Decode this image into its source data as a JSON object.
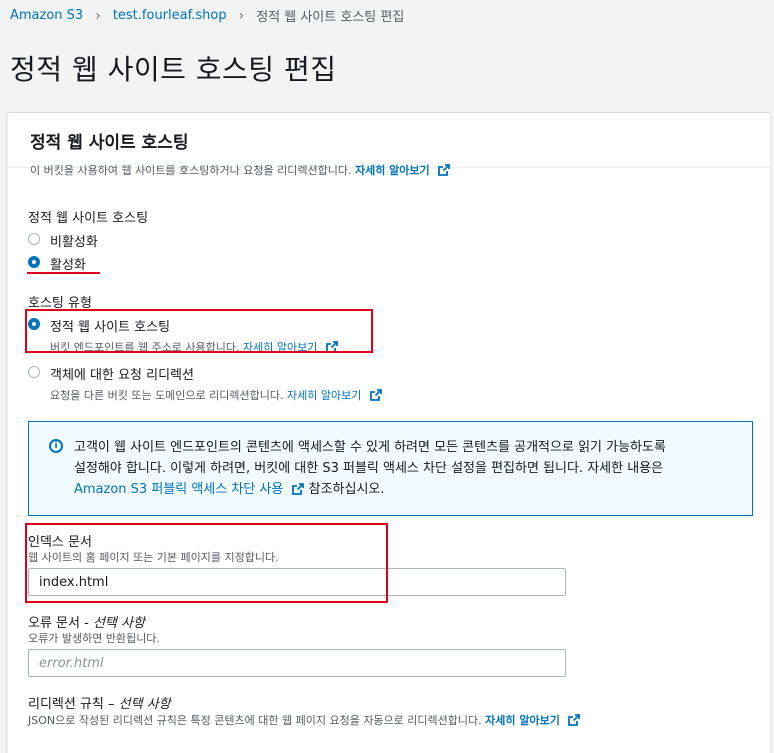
{
  "breadcrumb": {
    "root": "Amazon S3",
    "bucket": "test.fourleaf.shop",
    "current": "정적 웹 사이트 호스팅 편집"
  },
  "page_title": "정적 웹 사이트 호스팅 편집",
  "panel": {
    "title": "정적 웹 사이트 호스팅",
    "desc": "이 버킷을 사용하여 웹 사이트를 호스팅하거나 요청을 리디렉션합니다.",
    "learn_more": "자세히 알아보기"
  },
  "hosting": {
    "label": "정적 웹 사이트 호스팅",
    "opt_disable": "비활성화",
    "opt_enable": "활성화"
  },
  "hosting_type": {
    "label": "호스팅 유형",
    "opt_static": "정적 웹 사이트 호스팅",
    "opt_static_desc": "버킷 엔드포인트를 웹 주소로 사용합니다.",
    "opt_redirect": "객체에 대한 요청 리디렉션",
    "opt_redirect_desc": "요청을 다른 버킷 또는 도메인으로 리디렉션합니다.",
    "learn_more": "자세히 알아보기"
  },
  "info": {
    "line1": "고객이 웹 사이트 엔드포인트의 콘텐츠에 액세스할 수 있게 하려면 모든 콘텐츠를 공개적으로 읽기 가능하도록",
    "line2": "설정해야 합니다. 이렇게 하려면, 버킷에 대한 S3 퍼블릭 액세스 차단 설정을 편집하면 됩니다. 자세한 내용은",
    "link": "Amazon S3 퍼블릭 액세스 차단 사용",
    "tail": "참조하십시오."
  },
  "index_doc": {
    "label": "인덱스 문서",
    "desc": "웹 사이트의 홈 페이지 또는 기본 페이지를 지정합니다.",
    "value": "index.html"
  },
  "error_doc": {
    "label": "오류 문서 - ",
    "optional": "선택 사항",
    "desc": "오류가 발생하면 반환됩니다.",
    "placeholder": "error.html"
  },
  "redirect_rules": {
    "label": "리디렉션 규칙 – ",
    "optional": "선택 사항",
    "desc": "JSON으로 작성된 리디렉션 규칙은 특정 콘텐츠에 대한 웹 페이지 요청을 자동으로 리디렉션합니다.",
    "learn_more": "자세히 알아보기"
  },
  "colors": {
    "accent": "#0073bb",
    "highlight": "#e0001a"
  }
}
